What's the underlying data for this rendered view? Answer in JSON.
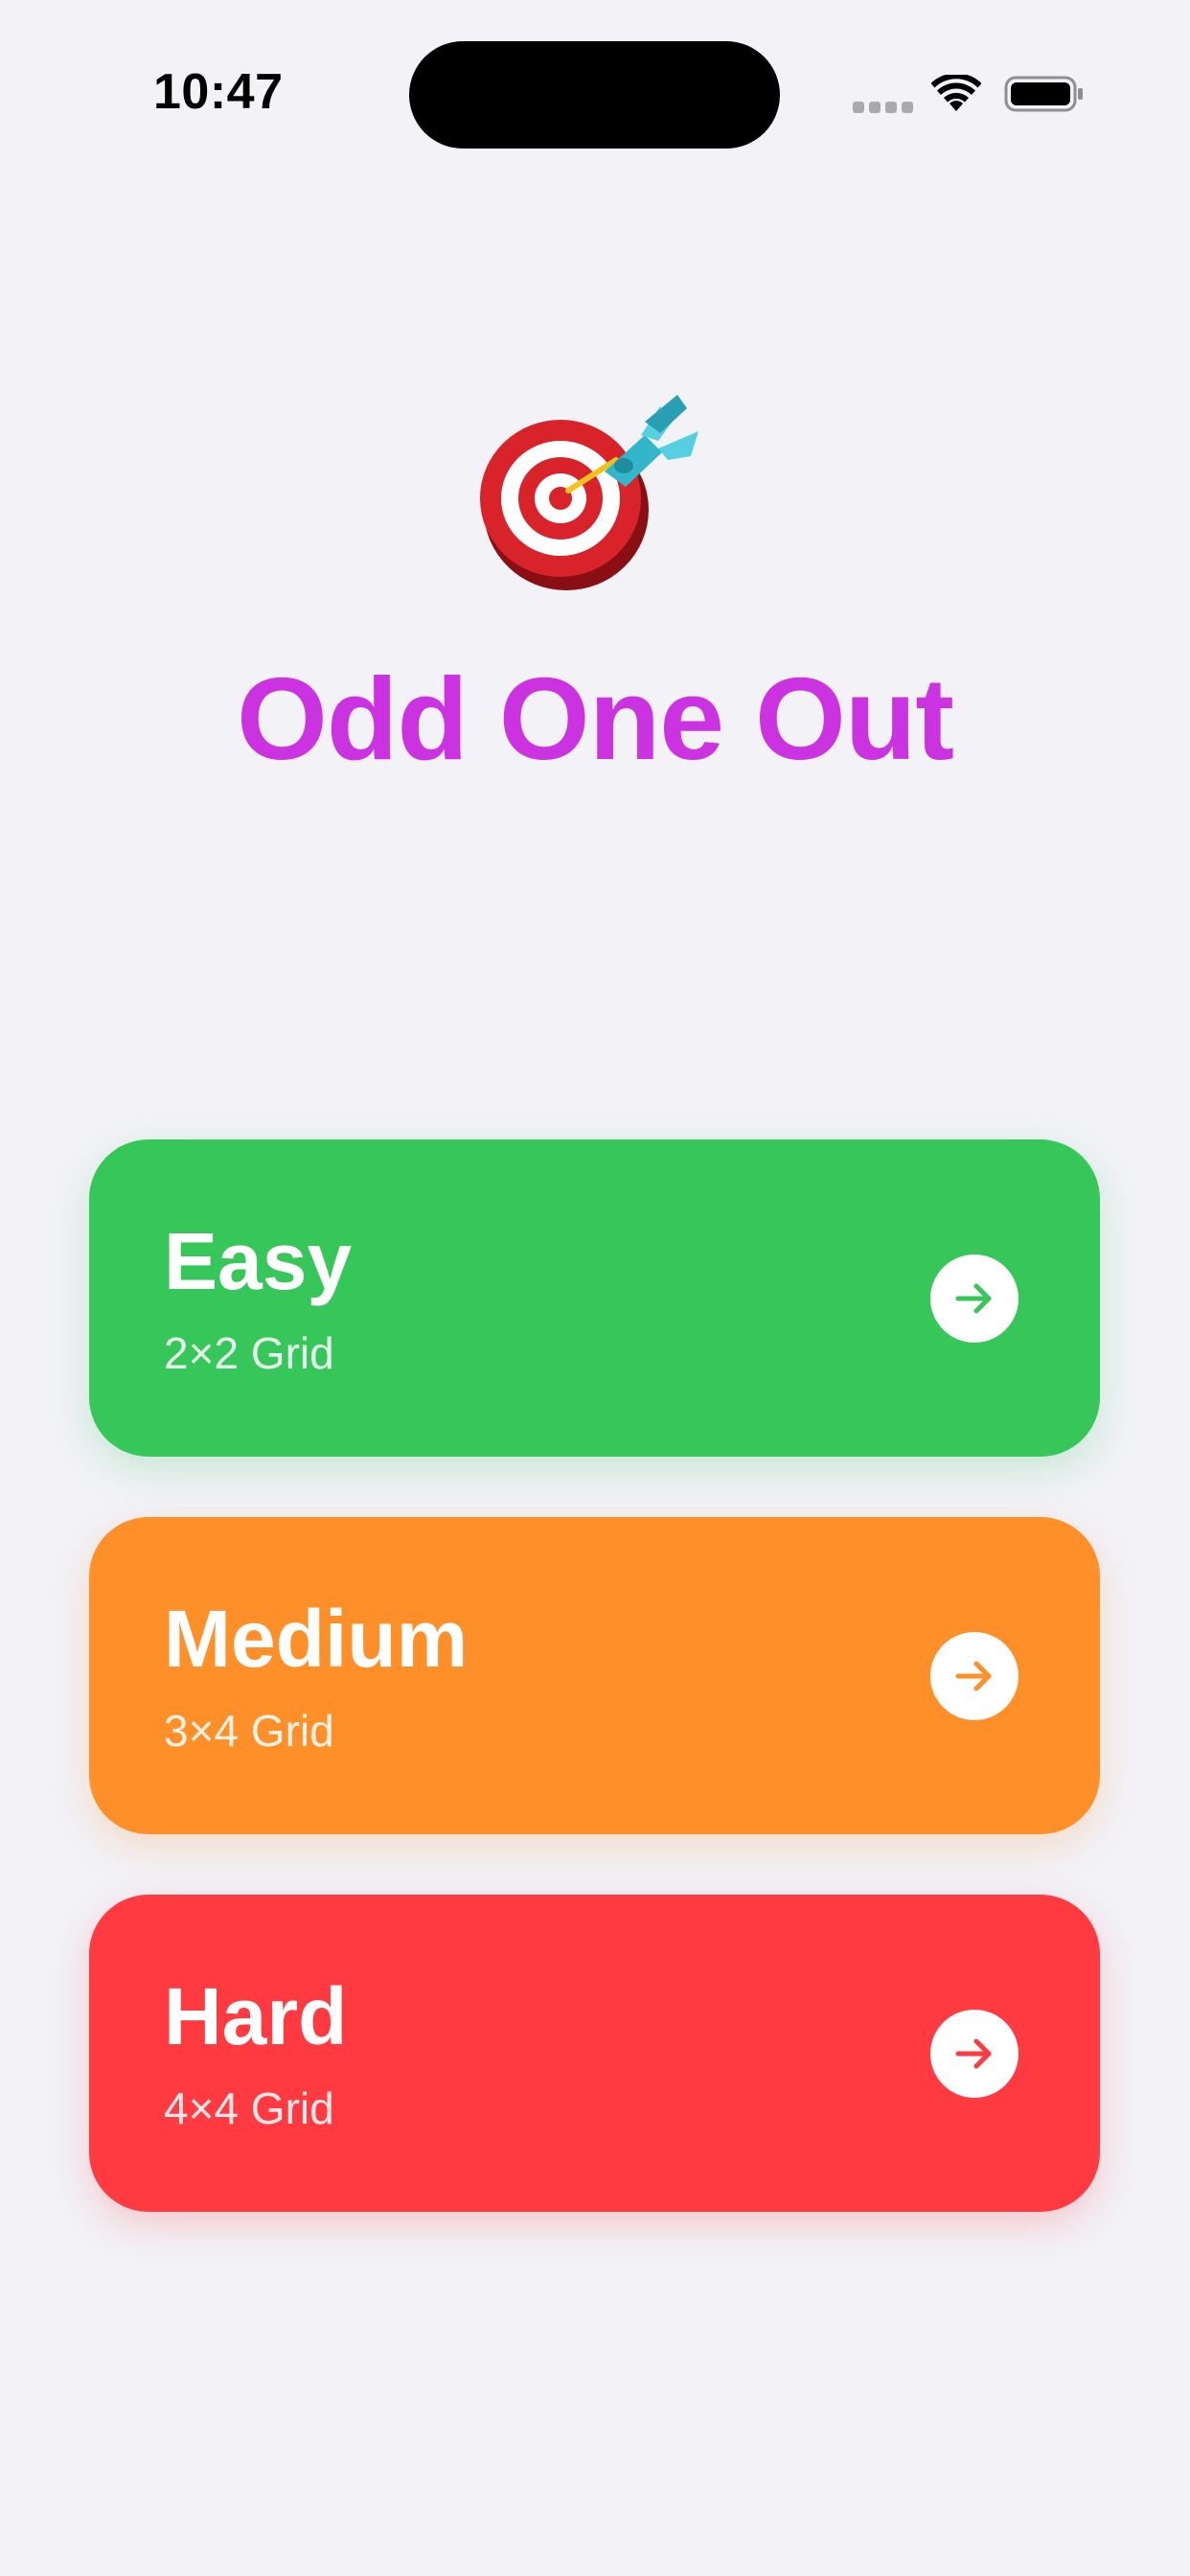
{
  "status_bar": {
    "time": "10:47"
  },
  "app": {
    "title": "Odd One Out",
    "icon": "target-with-dart-icon"
  },
  "levels": [
    {
      "title": "Easy",
      "subtitle": "2×2 Grid",
      "color": "#37c65a",
      "icon": "arrow-right-circle-icon"
    },
    {
      "title": "Medium",
      "subtitle": "3×4 Grid",
      "color": "#ff8f29",
      "icon": "arrow-right-circle-icon"
    },
    {
      "title": "Hard",
      "subtitle": "4×4 Grid",
      "color": "#ff3a41",
      "icon": "arrow-right-circle-icon"
    }
  ],
  "colors": {
    "background": "#f2f2f7",
    "title": "#cc33e0"
  }
}
